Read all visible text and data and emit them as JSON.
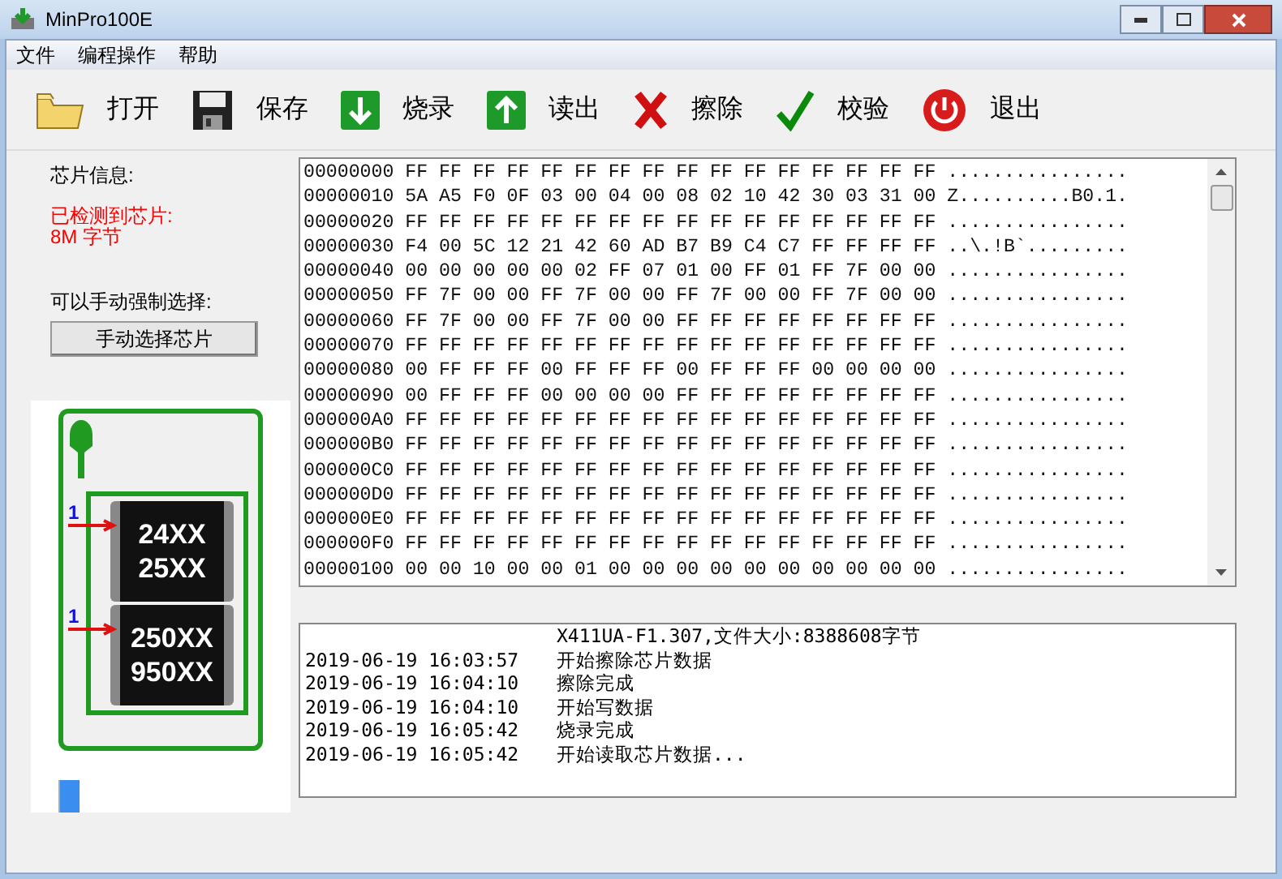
{
  "window": {
    "title": "MinPro100E"
  },
  "menu": [
    "文件",
    "编程操作",
    "帮助"
  ],
  "toolbar": [
    {
      "kind": "open",
      "label": "打开"
    },
    {
      "kind": "save",
      "label": "保存"
    },
    {
      "kind": "burn",
      "label": "烧录"
    },
    {
      "kind": "read",
      "label": "读出"
    },
    {
      "kind": "erase",
      "label": "擦除"
    },
    {
      "kind": "verify",
      "label": "校验"
    },
    {
      "kind": "exit",
      "label": "退出"
    }
  ],
  "chip_info": {
    "heading": "芯片信息:",
    "detected": "已检测到芯片:",
    "size": "8M 字节",
    "manual_label": "可以手动强制选择:",
    "manual_button": "手动选择芯片"
  },
  "chip_diagram": {
    "chips": [
      {
        "pin_mark": "1",
        "lines": [
          "24XX",
          "25XX"
        ]
      },
      {
        "pin_mark": "1",
        "lines": [
          "250XX",
          "950XX"
        ]
      }
    ]
  },
  "progress": {
    "level": 0.1
  },
  "hex_rows": [
    {
      "address": "00000000",
      "bytes": "FF FF FF FF FF FF FF FF FF FF FF FF FF FF FF FF",
      "ascii": "................"
    },
    {
      "address": "00000010",
      "bytes": "5A A5 F0 0F 03 00 04 00 08 02 10 42 30 03 31 00",
      "ascii": "Z..........B0.1."
    },
    {
      "address": "00000020",
      "bytes": "FF FF FF FF FF FF FF FF FF FF FF FF FF FF FF FF",
      "ascii": "................"
    },
    {
      "address": "00000030",
      "bytes": "F4 00 5C 12 21 42 60 AD B7 B9 C4 C7 FF FF FF FF",
      "ascii": "..\\.!B`........."
    },
    {
      "address": "00000040",
      "bytes": "00 00 00 00 00 02 FF 07 01 00 FF 01 FF 7F 00 00",
      "ascii": "................"
    },
    {
      "address": "00000050",
      "bytes": "FF 7F 00 00 FF 7F 00 00 FF 7F 00 00 FF 7F 00 00",
      "ascii": "................"
    },
    {
      "address": "00000060",
      "bytes": "FF 7F 00 00 FF 7F 00 00 FF FF FF FF FF FF FF FF",
      "ascii": "................"
    },
    {
      "address": "00000070",
      "bytes": "FF FF FF FF FF FF FF FF FF FF FF FF FF FF FF FF",
      "ascii": "................"
    },
    {
      "address": "00000080",
      "bytes": "00 FF FF FF 00 FF FF FF 00 FF FF FF 00 00 00 00",
      "ascii": "................"
    },
    {
      "address": "00000090",
      "bytes": "00 FF FF FF 00 00 00 00 FF FF FF FF FF FF FF FF",
      "ascii": "................"
    },
    {
      "address": "000000A0",
      "bytes": "FF FF FF FF FF FF FF FF FF FF FF FF FF FF FF FF",
      "ascii": "................"
    },
    {
      "address": "000000B0",
      "bytes": "FF FF FF FF FF FF FF FF FF FF FF FF FF FF FF FF",
      "ascii": "................"
    },
    {
      "address": "000000C0",
      "bytes": "FF FF FF FF FF FF FF FF FF FF FF FF FF FF FF FF",
      "ascii": "................"
    },
    {
      "address": "000000D0",
      "bytes": "FF FF FF FF FF FF FF FF FF FF FF FF FF FF FF FF",
      "ascii": "................"
    },
    {
      "address": "000000E0",
      "bytes": "FF FF FF FF FF FF FF FF FF FF FF FF FF FF FF FF",
      "ascii": "................"
    },
    {
      "address": "000000F0",
      "bytes": "FF FF FF FF FF FF FF FF FF FF FF FF FF FF FF FF",
      "ascii": "................"
    },
    {
      "address": "00000100",
      "bytes": "00 00 10 00 00 01 00 00 00 00 00 00 00 00 00 00",
      "ascii": "................"
    }
  ],
  "log": [
    {
      "message": "X411UA-F1.307,文件大小:8388608字节"
    },
    {
      "time": "2019-06-19 16:03:57",
      "message": "开始擦除芯片数据"
    },
    {
      "time": "2019-06-19 16:04:10",
      "message": "擦除完成"
    },
    {
      "time": "2019-06-19 16:04:10",
      "message": "开始写数据"
    },
    {
      "time": "2019-06-19 16:05:42",
      "message": "烧录完成"
    },
    {
      "time": "2019-06-19 16:05:42",
      "message": "开始读取芯片数据..."
    }
  ]
}
